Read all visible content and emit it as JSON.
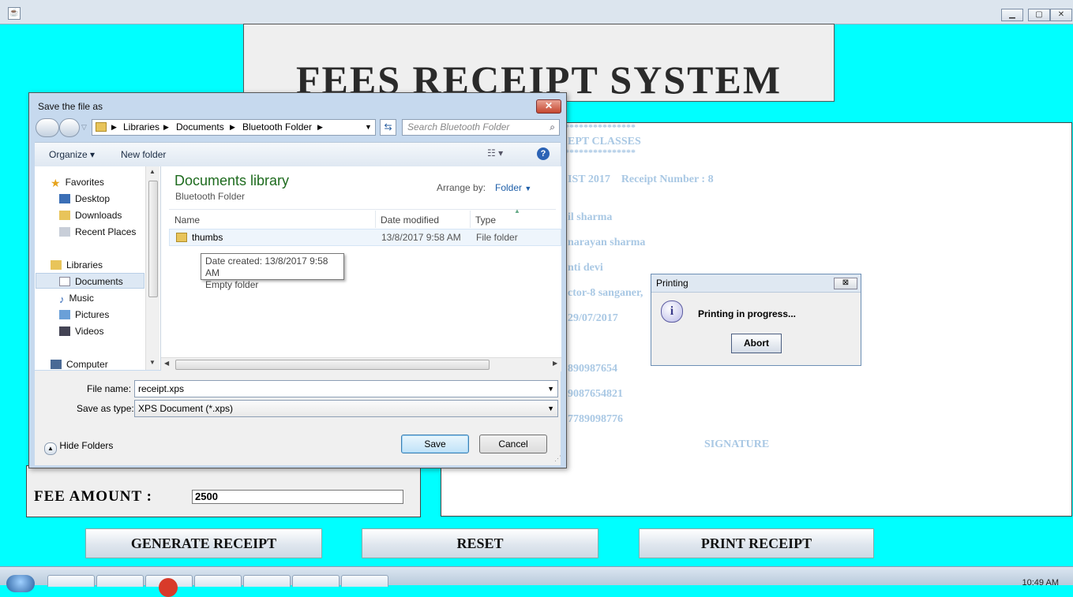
{
  "window": {
    "minimize_label": "▁",
    "maximize_label": "▢",
    "close_label": "✕"
  },
  "header": {
    "title": "FEES RECEIPT SYSTEM"
  },
  "receipt": {
    "stars_1": "****************",
    "line_classes": "EPT CLASSES",
    "stars_2": "****************",
    "line_date": "IST 2017    Receipt Number : 8",
    "line_name": "il sharma",
    "line_father": "narayan sharma",
    "line_mother": "nti devi",
    "line_address": "ctor-8 sanganer,",
    "line_dob": "29/07/2017",
    "line_phone1": "890987654",
    "line_phone2": "9087654821",
    "line_phone3": "7789098776",
    "signature": "SIGNATURE"
  },
  "form": {
    "fee_label": "FEE AMOUNT :",
    "fee_value": "2500"
  },
  "buttons": {
    "generate": "GENERATE RECEIPT",
    "reset": "RESET",
    "print": "PRINT RECEIPT"
  },
  "save_dialog": {
    "title": "Save the file as",
    "close_label": "✕",
    "breadcrumb": [
      "Libraries",
      "Documents",
      "Bluetooth Folder"
    ],
    "search_placeholder": "Search Bluetooth Folder",
    "toolbar": {
      "organize": "Organize ▾",
      "new_folder": "New folder"
    },
    "nav": {
      "favorites": "Favorites",
      "desktop": "Desktop",
      "downloads": "Downloads",
      "recent_places": "Recent Places",
      "libraries": "Libraries",
      "documents": "Documents",
      "music": "Music",
      "pictures": "Pictures",
      "videos": "Videos",
      "computer": "Computer"
    },
    "library_title": "Documents library",
    "library_subtitle": "Bluetooth Folder",
    "arrange_label": "Arrange by:",
    "arrange_value": "Folder",
    "columns": {
      "name": "Name",
      "date_modified": "Date modified",
      "type": "Type"
    },
    "rows": [
      {
        "name": "thumbs",
        "date": "13/8/2017 9:58 AM",
        "type": "File folder"
      }
    ],
    "tooltip": {
      "line1": "Date created: 13/8/2017 9:58 AM",
      "line2": "Empty folder"
    },
    "file_name_label": "File name:",
    "file_name_value": "receipt.xps",
    "save_type_label": "Save as type:",
    "save_type_value": "XPS Document (*.xps)",
    "hide_folders": "Hide Folders",
    "save_button": "Save",
    "cancel_button": "Cancel"
  },
  "print_dialog": {
    "title": "Printing",
    "close_label": "⊠",
    "message": "Printing in progress...",
    "abort": "Abort"
  },
  "taskbar": {
    "clock": "10:49 AM"
  },
  "colors": {
    "background": "#00ffff",
    "receipt_text": "#a9c8e4",
    "library_title": "#1e6b1e"
  }
}
